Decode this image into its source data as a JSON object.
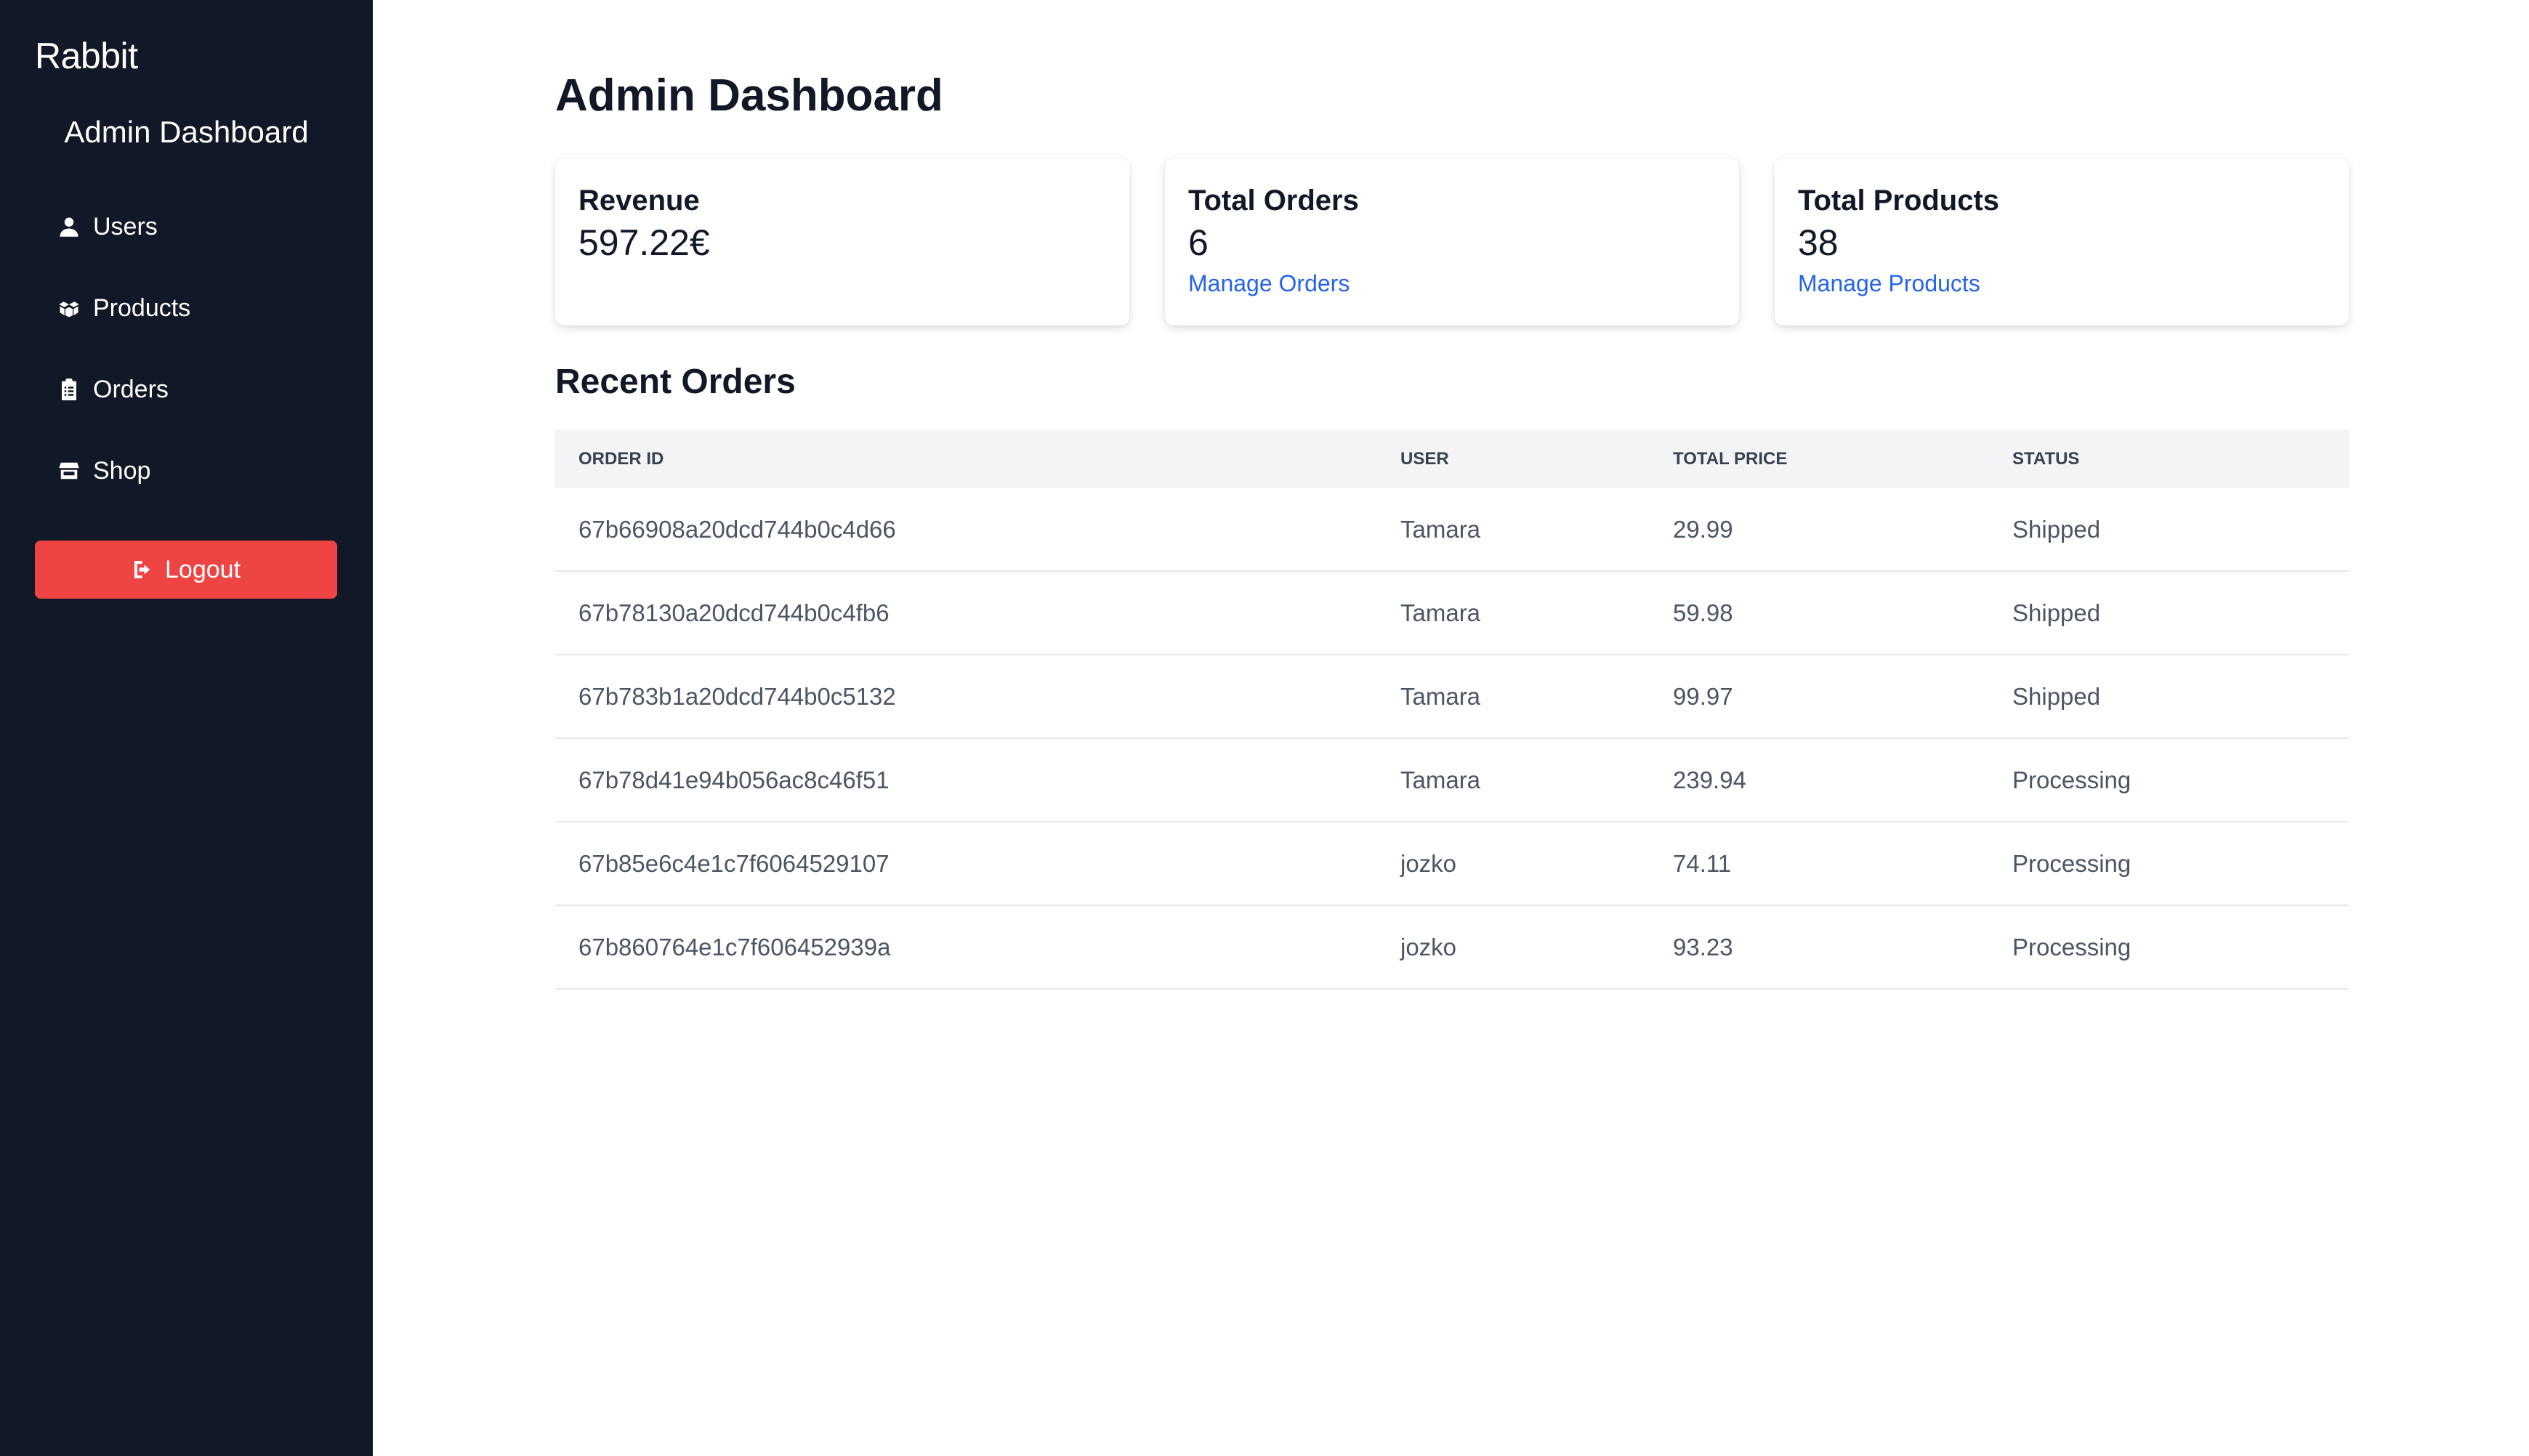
{
  "sidebar": {
    "brand": "Rabbit",
    "title": "Admin Dashboard",
    "items": [
      {
        "label": "Users",
        "icon": "user-icon"
      },
      {
        "label": "Products",
        "icon": "boxes-icon"
      },
      {
        "label": "Orders",
        "icon": "clipboard-list-icon"
      },
      {
        "label": "Shop",
        "icon": "store-icon"
      }
    ],
    "logout_label": "Logout"
  },
  "main": {
    "title": "Admin Dashboard",
    "cards": [
      {
        "title": "Revenue",
        "value": "597.22€"
      },
      {
        "title": "Total Orders",
        "value": "6",
        "link": "Manage Orders"
      },
      {
        "title": "Total Products",
        "value": "38",
        "link": "Manage Products"
      }
    ],
    "recent_orders": {
      "title": "Recent Orders",
      "columns": [
        "Order ID",
        "User",
        "Total Price",
        "Status"
      ],
      "rows": [
        [
          "67b66908a20dcd744b0c4d66",
          "Tamara",
          "29.99",
          "Shipped"
        ],
        [
          "67b78130a20dcd744b0c4fb6",
          "Tamara",
          "59.98",
          "Shipped"
        ],
        [
          "67b783b1a20dcd744b0c5132",
          "Tamara",
          "99.97",
          "Shipped"
        ],
        [
          "67b78d41e94b056ac8c46f51",
          "Tamara",
          "239.94",
          "Processing"
        ],
        [
          "67b85e6c4e1c7f6064529107",
          "jozko",
          "74.11",
          "Processing"
        ],
        [
          "67b860764e1c7f606452939a",
          "jozko",
          "93.23",
          "Processing"
        ]
      ]
    }
  },
  "colors": {
    "sidebar_bg": "#111827",
    "logout_bg": "#ef4444",
    "link": "#2563eb",
    "table_header_bg": "#f3f4f6"
  }
}
